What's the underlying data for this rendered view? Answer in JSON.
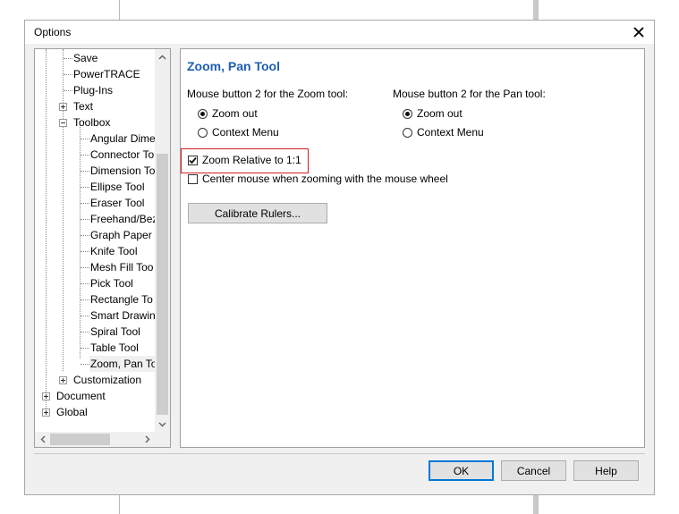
{
  "dialog": {
    "title": "Options",
    "close_symbol": "✕"
  },
  "tree": {
    "items": [
      {
        "label": "Save"
      },
      {
        "label": "PowerTRACE"
      },
      {
        "label": "Plug-Ins"
      },
      {
        "label": "Text",
        "expander": "plus"
      },
      {
        "label": "Toolbox",
        "expander": "minus"
      },
      {
        "label": "Angular Dime"
      },
      {
        "label": "Connector To"
      },
      {
        "label": "Dimension To"
      },
      {
        "label": "Ellipse Tool"
      },
      {
        "label": "Eraser Tool"
      },
      {
        "label": "Freehand/Bez"
      },
      {
        "label": "Graph Paper T"
      },
      {
        "label": "Knife Tool"
      },
      {
        "label": "Mesh Fill Too"
      },
      {
        "label": "Pick Tool"
      },
      {
        "label": "Rectangle To"
      },
      {
        "label": "Smart Drawin"
      },
      {
        "label": "Spiral Tool"
      },
      {
        "label": "Table Tool"
      },
      {
        "label": "Zoom, Pan To",
        "selected": true
      },
      {
        "label": "Customization",
        "expander": "plus"
      },
      {
        "label": "Document",
        "expander": "plus"
      },
      {
        "label": "Global",
        "expander": "plus"
      }
    ]
  },
  "content": {
    "heading": "Zoom, Pan Tool",
    "zoom_group": {
      "label": "Mouse button 2 for the Zoom tool:",
      "options": [
        "Zoom out",
        "Context Menu"
      ],
      "selected": "Zoom out"
    },
    "pan_group": {
      "label": "Mouse button 2 for the Pan tool:",
      "options": [
        "Zoom out",
        "Context Menu"
      ],
      "selected": "Zoom out"
    },
    "zoom_relative": {
      "label": "Zoom Relative to 1:1",
      "checked": true
    },
    "center_mouse": {
      "label": "Center mouse when zooming with the mouse wheel",
      "checked": false
    },
    "calibrate_button": "Calibrate Rulers..."
  },
  "footer": {
    "ok": "OK",
    "cancel": "Cancel",
    "help": "Help"
  },
  "colors": {
    "heading": "#1e5fb4",
    "highlight_border": "#d02020",
    "default_button_border": "#0078d7"
  }
}
